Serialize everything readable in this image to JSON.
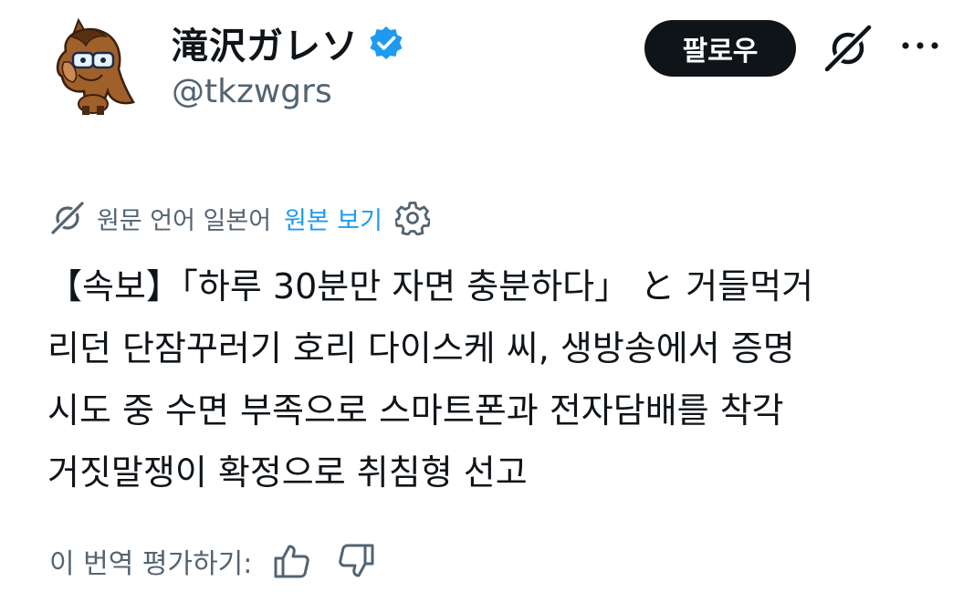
{
  "profile": {
    "display_name": "滝沢ガレソ",
    "handle": "@tkzwgrs",
    "verified_badge_icon": "verified-badge-icon",
    "follow_label": "팔로우"
  },
  "translation": {
    "source_language_text": "원문 언어 일본어",
    "show_original_label": "원본 보기"
  },
  "tweet": {
    "lines": [
      "【속보】「하루 30분만 자면 충분하다」 と 거들먹거",
      "리던 단잠꾸러기 호리 다이스케 씨, 생방송에서 증명",
      "시도 중 수면 부족으로 스마트폰과 전자담배를 착각",
      "거짓말쟁이 확정으로 취침형 선고"
    ]
  },
  "rating": {
    "label": "이 번역 평가하기:"
  },
  "colors": {
    "text_primary": "#0f1419",
    "text_secondary": "#536471",
    "accent": "#1d9bf0",
    "button_bg": "#0f1419"
  }
}
